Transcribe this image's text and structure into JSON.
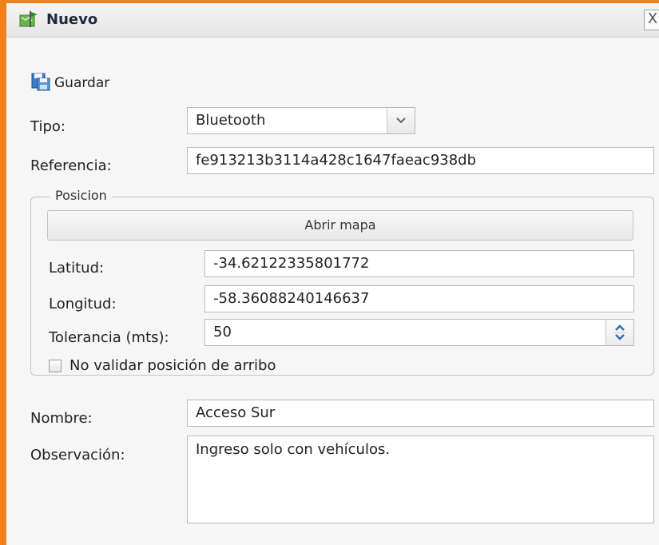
{
  "window": {
    "title": "Nuevo",
    "close_glyph": "X"
  },
  "toolbar": {
    "save_label": "Guardar"
  },
  "form": {
    "tipo": {
      "label": "Tipo:",
      "value": "Bluetooth"
    },
    "referencia": {
      "label": "Referencia:",
      "value": "fe913213b3114a428c1647faeac938db"
    },
    "posicion": {
      "legend": "Posicion",
      "map_button": "Abrir mapa",
      "latitud": {
        "label": "Latitud:",
        "value": "-34.62122335801772"
      },
      "longitud": {
        "label": "Longitud:",
        "value": "-58.36088240146637"
      },
      "tolerancia": {
        "label": "Tolerancia (mts):",
        "value": "50"
      },
      "no_validar": {
        "label": "No validar posición de arribo",
        "checked": false
      }
    },
    "nombre": {
      "label": "Nombre:",
      "value": "Acceso Sur"
    },
    "observacion": {
      "label": "Observación:",
      "value": "Ingreso solo con vehículos."
    }
  },
  "icons": {
    "title": "flag-map-icon",
    "save": "save-icon",
    "select": "chevron-down-icon",
    "spinner": "spinner-arrows-icon"
  },
  "colors": {
    "window_border": "#f0821e",
    "icon_blue": "#2f6db3"
  }
}
